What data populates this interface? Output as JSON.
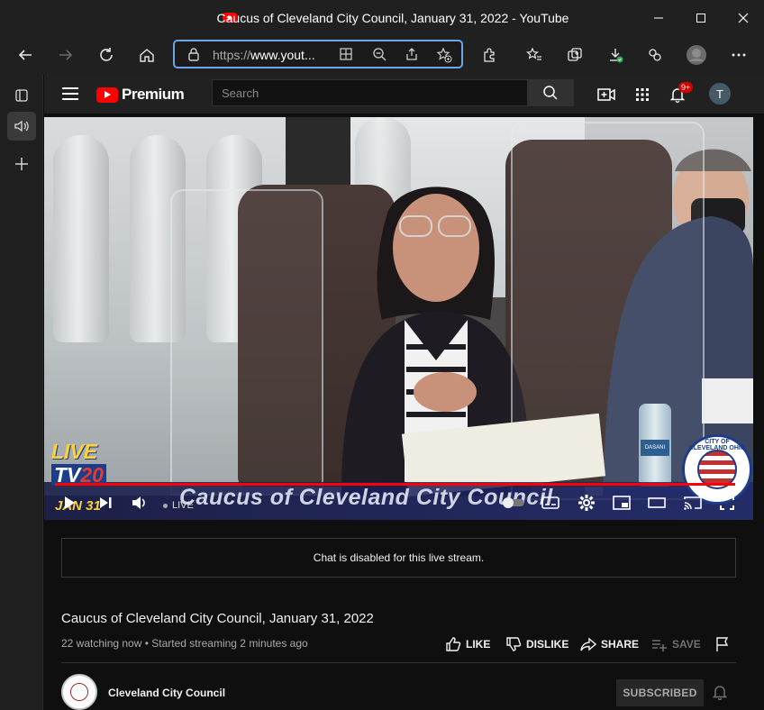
{
  "window": {
    "title": "Caucus of Cleveland City Council, January 31, 2022 - YouTube",
    "controls": {
      "minimize_icon": "minimize-icon",
      "maximize_icon": "maximize-icon",
      "close_icon": "close-icon"
    }
  },
  "browser": {
    "url_prefix": "https://",
    "url_host": "www.yout...",
    "accent": "#6aa6e8",
    "icons": [
      "back-icon",
      "forward-icon",
      "refresh-icon",
      "home-icon",
      "lock-icon",
      "apps-icon",
      "zoom-out-icon",
      "share-icon",
      "favorite-add-icon",
      "extensions-icon",
      "favorites-icon",
      "collections-icon",
      "downloads-icon",
      "copilot-icon",
      "profile-icon",
      "more-icon"
    ]
  },
  "youtube": {
    "logo_text": "Premium",
    "search_placeholder": "Search",
    "notification_badge": "9+",
    "avatar_letter": "T",
    "brand_color": "#ff0000"
  },
  "video": {
    "overlay_title": "Caucus of Cleveland City Council",
    "live_logo_line1": "LIVE",
    "live_logo_tv": "TV",
    "live_logo_num": "20",
    "date_overlay": "JAN 31",
    "seal_text": "CITY OF CLEVELAND OHIO",
    "live_label": "LIVE",
    "progress": 0.99,
    "bottle_label": "DASANI"
  },
  "chat": {
    "message": "Chat is disabled for this live stream."
  },
  "info": {
    "title": "Caucus of Cleveland City Council, January 31, 2022",
    "meta": "22 watching now • Started streaming 2 minutes ago",
    "like": "LIKE",
    "dislike": "DISLIKE",
    "share": "SHARE",
    "save": "SAVE"
  },
  "channel": {
    "name": "Cleveland City Council",
    "subscribe_label": "SUBSCRIBED"
  }
}
